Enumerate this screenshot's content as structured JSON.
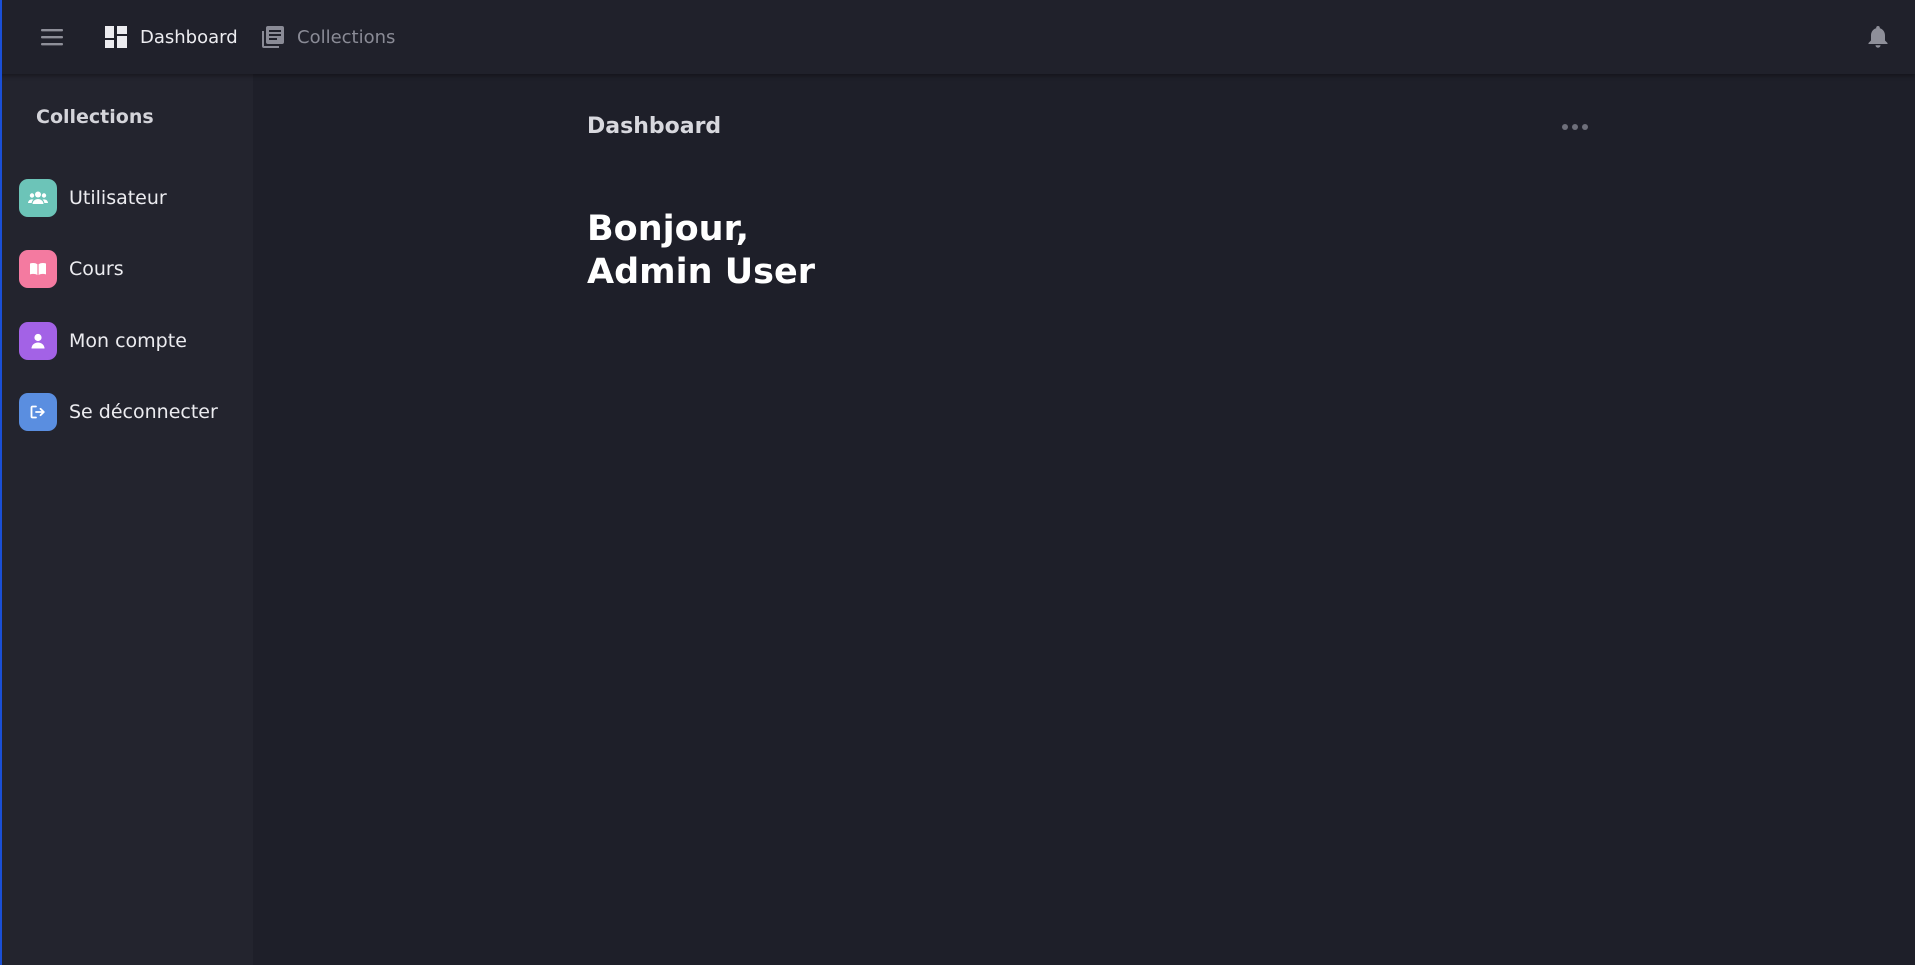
{
  "topbar": {
    "menu_icon": "hamburger-menu-icon",
    "nav": [
      {
        "label": "Dashboard",
        "icon": "dashboard-grid-icon",
        "active": true
      },
      {
        "label": "Collections",
        "icon": "collections-stack-icon",
        "active": false
      }
    ],
    "notifications_icon": "bell-icon"
  },
  "sidebar": {
    "title": "Collections",
    "items": [
      {
        "label": "Utilisateur",
        "icon": "users-icon",
        "color": "#6cc4b8"
      },
      {
        "label": "Cours",
        "icon": "book-icon",
        "color": "#f47aa0"
      },
      {
        "label": "Mon compte",
        "icon": "user-icon",
        "color": "#a362e6"
      },
      {
        "label": "Se déconnecter",
        "icon": "logout-icon",
        "color": "#5a8ee0"
      }
    ]
  },
  "main": {
    "title": "Dashboard",
    "more_icon": "more-dots-icon",
    "greeting_line1": "Bonjour,",
    "greeting_line2": "Admin User"
  }
}
